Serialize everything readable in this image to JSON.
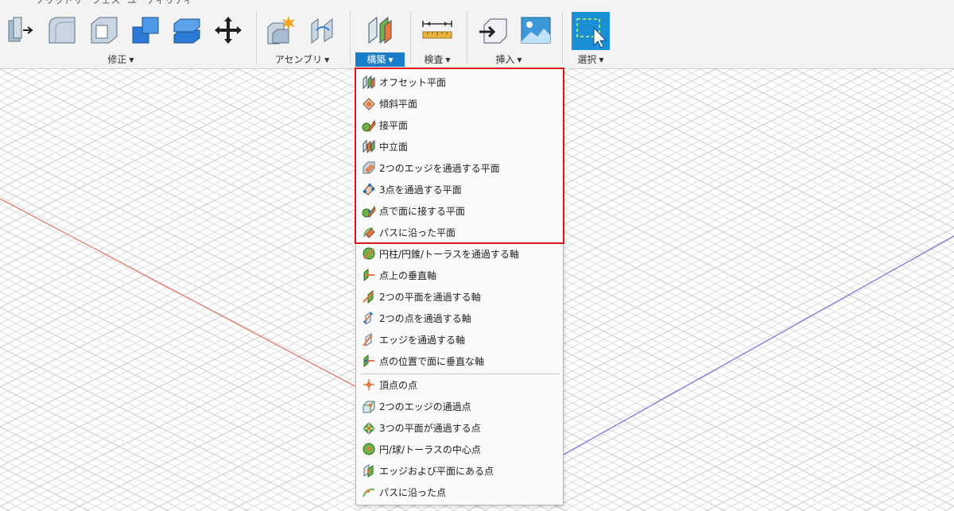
{
  "toolbar": {
    "cut_labels": [
      "ソリッドサーフェス",
      "ユーティリティ"
    ],
    "groups": {
      "modify": "修正",
      "assemble": "アセンブリ",
      "construct": "構築",
      "inspect": "検査",
      "insert": "挿入",
      "select": "選択"
    },
    "colors": {
      "accent": "#1a7dc9",
      "select_tile": "#1a8fd6"
    }
  },
  "menu": {
    "highlight_color": "#e0141a",
    "planes": [
      {
        "label": "オフセット平面",
        "icon": "offset-plane-icon"
      },
      {
        "label": "傾斜平面",
        "icon": "plane-at-angle-icon"
      },
      {
        "label": "接平面",
        "icon": "tangent-plane-icon"
      },
      {
        "label": "中立面",
        "icon": "midplane-icon"
      },
      {
        "label": "2つのエッジを通過する平面",
        "icon": "plane-through-two-edges-icon"
      },
      {
        "label": "3点を通過する平面",
        "icon": "plane-through-three-points-icon"
      },
      {
        "label": "点で面に接する平面",
        "icon": "plane-tangent-at-point-icon"
      },
      {
        "label": "パスに沿った平面",
        "icon": "plane-along-path-icon"
      }
    ],
    "axes": [
      {
        "label": "円柱/円錐/トーラスを通過する軸",
        "icon": "axis-through-cylinder-icon"
      },
      {
        "label": "点上の垂直軸",
        "icon": "axis-perpendicular-at-point-icon"
      },
      {
        "label": "2つの平面を通過する軸",
        "icon": "axis-through-two-planes-icon"
      },
      {
        "label": "2つの点を通過する軸",
        "icon": "axis-through-two-points-icon"
      },
      {
        "label": "エッジを通過する軸",
        "icon": "axis-through-edge-icon"
      },
      {
        "label": "点の位置で面に垂直な軸",
        "icon": "axis-perpendicular-to-face-icon"
      }
    ],
    "points": [
      {
        "label": "頂点の点",
        "icon": "point-at-vertex-icon"
      },
      {
        "label": "2つのエッジの通過点",
        "icon": "point-through-two-edges-icon"
      },
      {
        "label": "3つの平面が通過する点",
        "icon": "point-through-three-planes-icon"
      },
      {
        "label": "円/球/トーラスの中心点",
        "icon": "point-at-center-icon"
      },
      {
        "label": "エッジおよび平面にある点",
        "icon": "point-at-edge-and-plane-icon"
      },
      {
        "label": "パスに沿った点",
        "icon": "point-along-path-icon"
      }
    ]
  }
}
